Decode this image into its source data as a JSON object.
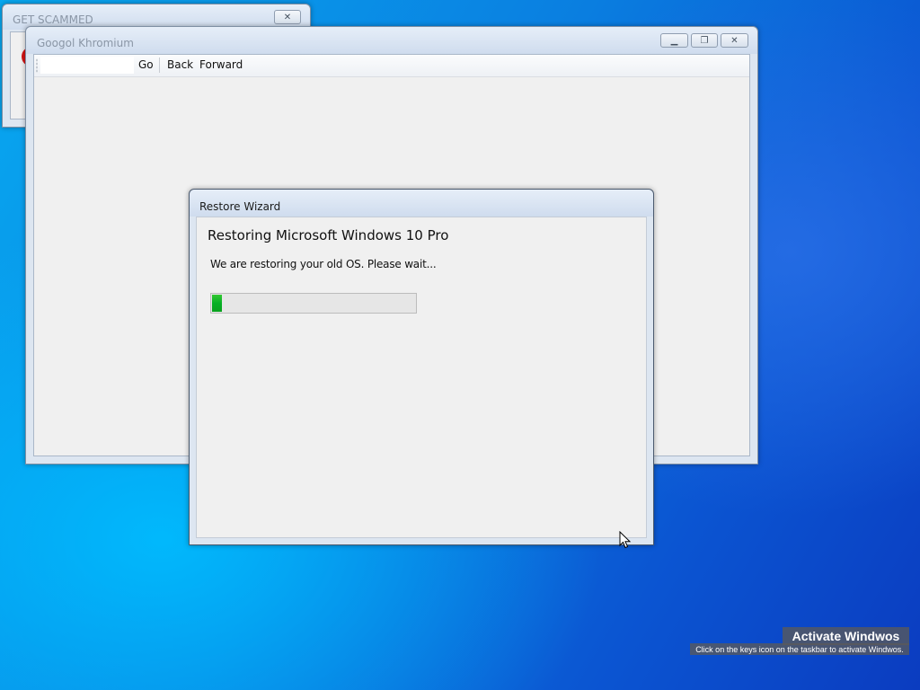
{
  "windows": {
    "scam": {
      "title": "GET SCAMMED",
      "close_glyph": "✕"
    },
    "browser": {
      "title": "Googol Khromium",
      "minimize_glyph": "▁",
      "maximize_glyph": "❐",
      "close_glyph": "✕",
      "toolbar": {
        "url_value": "",
        "go_label": "Go",
        "back_label": "Back",
        "forward_label": "Forward"
      }
    },
    "wizard": {
      "title": "Restore Wizard",
      "heading": "Restoring Microsoft Windows 10 Pro",
      "message": "We are restoring your old OS. Please wait...",
      "progress_percent": 5,
      "progress_color": "#06b025"
    }
  },
  "watermark": {
    "title": "Activate Windwos",
    "subtitle": "Click on the keys icon on the taskbar to activate Windwos."
  },
  "icons": [
    "close-icon",
    "minimize-icon",
    "maximize-icon",
    "mouse-cursor-icon",
    "alert-icon"
  ]
}
